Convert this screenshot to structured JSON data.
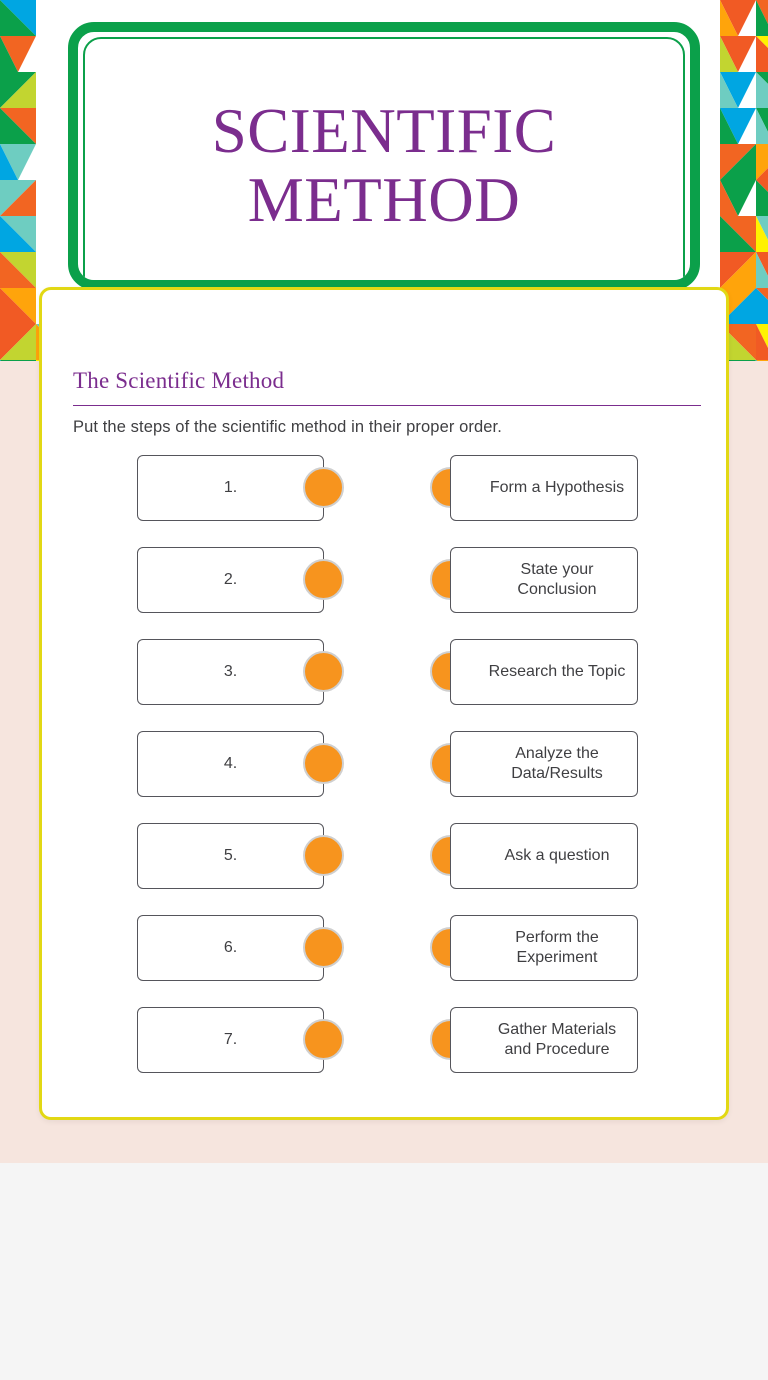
{
  "colors": {
    "title_purple": "#7b2d8e",
    "card_border_yellow": "#e2d814",
    "header_green": "#0ba04a",
    "dot_orange": "#f7941e",
    "page_pink": "#f6e5de",
    "page_gray": "#f5f5f5",
    "text_dark": "#3f3f42"
  },
  "header": {
    "title": "SCIENTIFIC METHOD",
    "title_line1": "SCIENTIFIC",
    "title_line2": "METHOD",
    "mosaic_palette": [
      "#0ba04a",
      "#6ecdc1",
      "#c2d530",
      "#fff200",
      "#f15a24",
      "#00a6e2",
      "#ffa40b",
      "#f26522"
    ]
  },
  "worksheet": {
    "heading": "The Scientific Method",
    "instruction": "Put the steps of the scientific method in their proper order.",
    "rows": [
      {
        "number": "1.",
        "answer": "Form a Hypothesis"
      },
      {
        "number": "2.",
        "answer": "State your Conclusion"
      },
      {
        "number": "3.",
        "answer": "Research the Topic"
      },
      {
        "number": "4.",
        "answer": "Analyze the Data/Results"
      },
      {
        "number": "5.",
        "answer": "Ask a question"
      },
      {
        "number": "6.",
        "answer": "Perform the Experiment"
      },
      {
        "number": "7.",
        "answer": "Gather Materials and Procedure"
      }
    ]
  }
}
